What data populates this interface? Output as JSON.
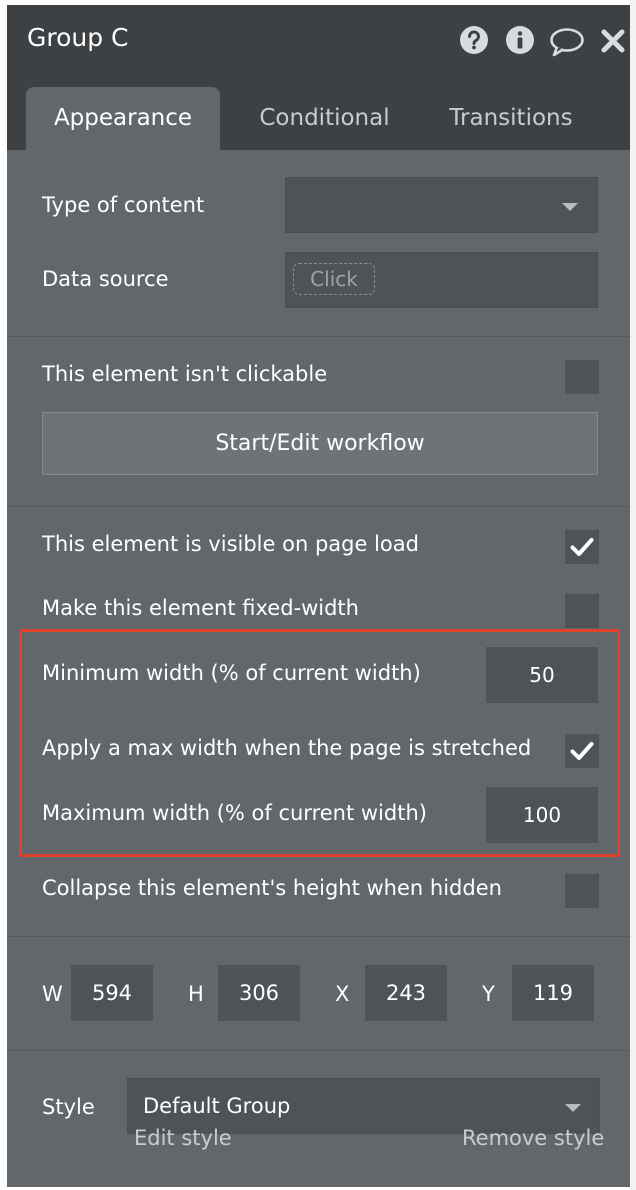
{
  "header": {
    "title": "Group C",
    "icons": [
      "question-circle-icon",
      "info-circle-icon",
      "speech-bubble-icon",
      "close-icon"
    ]
  },
  "tabs": [
    {
      "label": "Appearance",
      "active": true
    },
    {
      "label": "Conditional",
      "active": false
    },
    {
      "label": "Transitions",
      "active": false
    }
  ],
  "content": {
    "type_label": "Type of content",
    "type_value": "",
    "data_source_label": "Data source",
    "data_source_placeholder": "Click"
  },
  "clickable": {
    "label": "This element isn't clickable",
    "checked": false,
    "workflow_button": "Start/Edit workflow"
  },
  "layout": {
    "visible_label": "This element is visible on page load",
    "visible_checked": true,
    "fixed_width_label": "Make this element fixed-width",
    "fixed_width_checked": false,
    "min_width_label": "Minimum width (% of current width)",
    "min_width_value": "50",
    "max_apply_label": "Apply a max width when the page is stretched",
    "max_apply_checked": true,
    "max_width_label": "Maximum width (% of current width)",
    "max_width_value": "100",
    "collapse_label": "Collapse this element's height when hidden",
    "collapse_checked": false
  },
  "dimensions": {
    "w_label": "W",
    "w_value": "594",
    "h_label": "H",
    "h_value": "306",
    "x_label": "X",
    "x_value": "243",
    "y_label": "Y",
    "y_value": "119"
  },
  "style": {
    "label": "Style",
    "value": "Default Group",
    "edit_link": "Edit style",
    "remove_link": "Remove style"
  },
  "colors": {
    "panel": "#62676b",
    "header": "#3d4144",
    "field": "#4e5357",
    "highlight": "#e0412c"
  }
}
